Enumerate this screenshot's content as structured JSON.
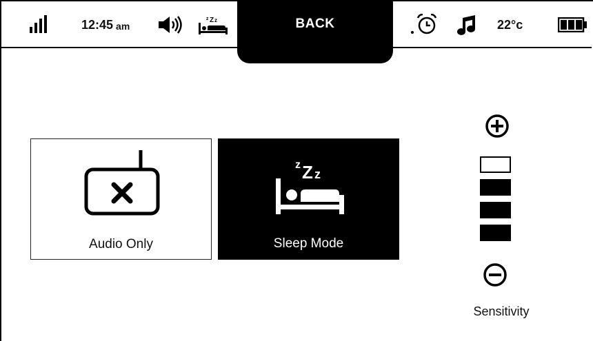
{
  "status": {
    "time": "12:45",
    "time_suffix": "am",
    "temperature": "22°c",
    "back_label": "BACK"
  },
  "icons": {
    "signal": "signal-bars-icon",
    "volume": "speaker-volume-icon",
    "sleep": "sleep-bed-icon",
    "alarm": "alarm-clock-icon",
    "music": "music-note-icon",
    "battery": "battery-full-icon"
  },
  "modes": [
    {
      "id": "audio",
      "label": "Audio Only",
      "icon": "camera-off-icon"
    },
    {
      "id": "sleep",
      "label": "Sleep Mode",
      "icon": "sleep-bed-icon",
      "selected": true
    }
  ],
  "sensitivity": {
    "label": "Sensitivity",
    "level": 3,
    "max": 4
  }
}
